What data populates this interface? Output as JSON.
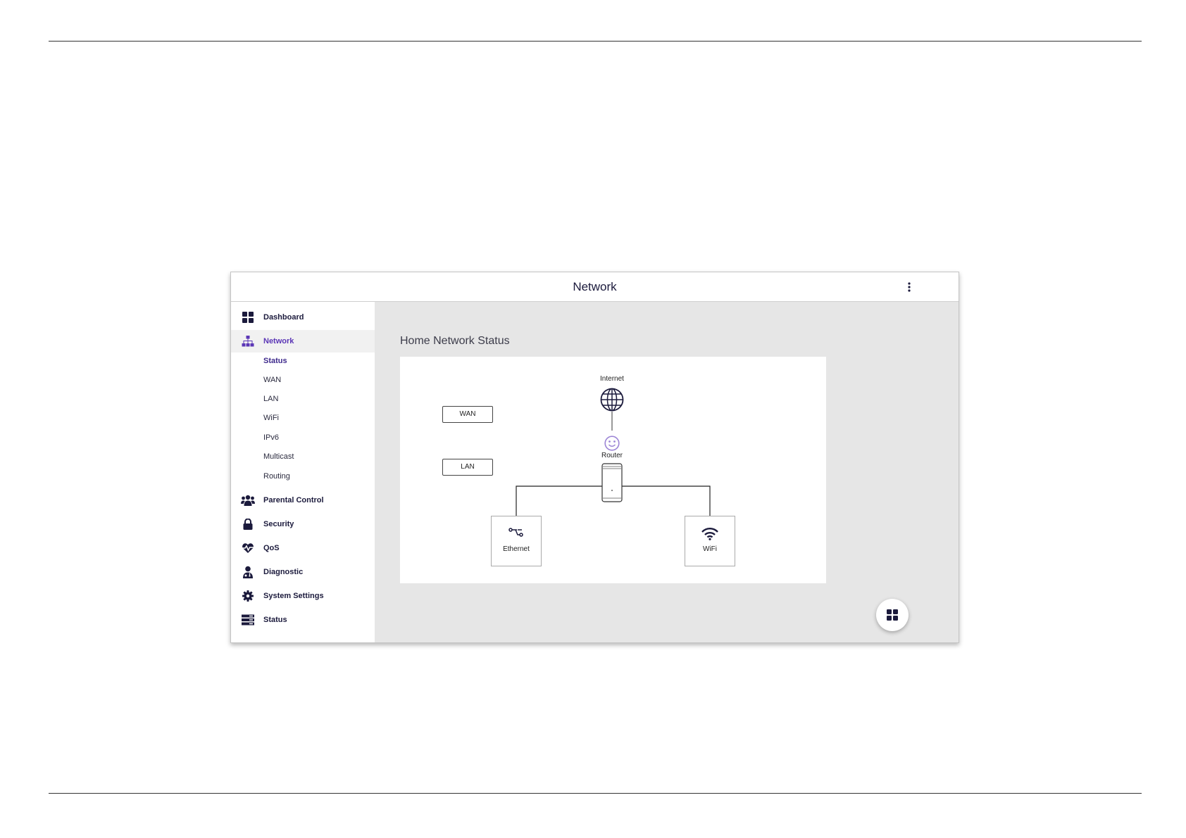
{
  "header": {
    "title": "Network",
    "menu_icon": "more-vertical-icon"
  },
  "sidebar": {
    "items": [
      {
        "label": "Dashboard",
        "icon": "dashboard-grid-icon"
      },
      {
        "label": "Network",
        "icon": "network-tree-icon",
        "active": true,
        "subitems": [
          {
            "label": "Status",
            "active": true
          },
          {
            "label": "WAN"
          },
          {
            "label": "LAN"
          },
          {
            "label": "WiFi"
          },
          {
            "label": "IPv6"
          },
          {
            "label": "Multicast"
          },
          {
            "label": "Routing"
          }
        ]
      },
      {
        "label": "Parental Control",
        "icon": "users-icon"
      },
      {
        "label": "Security",
        "icon": "lock-icon"
      },
      {
        "label": "QoS",
        "icon": "heart-pulse-icon"
      },
      {
        "label": "Diagnostic",
        "icon": "doctor-icon"
      },
      {
        "label": "System Settings",
        "icon": "gear-icon"
      },
      {
        "label": "Status",
        "icon": "server-icon"
      }
    ]
  },
  "main": {
    "section_title": "Home Network Status",
    "diagram": {
      "wan_button": "WAN",
      "lan_button": "LAN",
      "internet_label": "Internet",
      "router_label": "Router",
      "clients": [
        {
          "label": "Ethernet",
          "icon": "ethernet-icon"
        },
        {
          "label": "WiFi",
          "icon": "wifi-icon"
        }
      ]
    },
    "fab_icon": "dashboard-grid-icon"
  },
  "colors": {
    "primary_navy": "#1b1a3c",
    "accent_purple": "#5b36b6",
    "smiley_purple": "#9d86d6",
    "content_bg": "#e6e6e6"
  }
}
